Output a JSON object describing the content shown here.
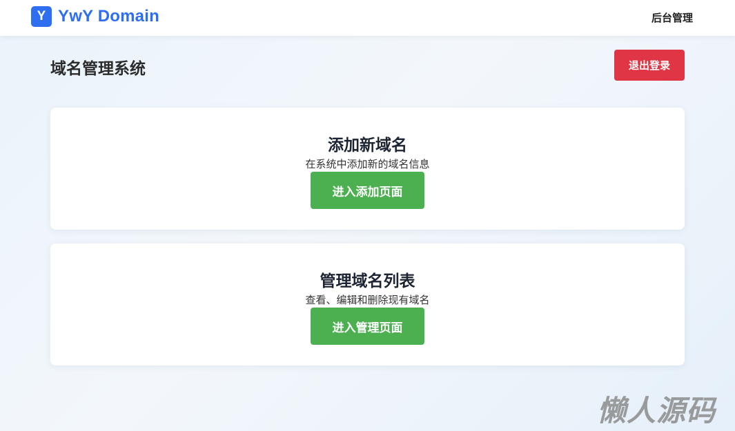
{
  "header": {
    "logo_letter": "Y",
    "logo_text": "YwY Domain",
    "nav_admin": "后台管理"
  },
  "page": {
    "title": "域名管理系统",
    "logout_label": "退出登录"
  },
  "cards": [
    {
      "title": "添加新域名",
      "description": "在系统中添加新的域名信息",
      "button_label": "进入添加页面"
    },
    {
      "title": "管理域名列表",
      "description": "查看、编辑和删除现有域名",
      "button_label": "进入管理页面"
    }
  ],
  "watermark": "懒人源码",
  "colors": {
    "brand": "#2d6ff0",
    "logout": "#df3545",
    "action": "#4caf50"
  }
}
